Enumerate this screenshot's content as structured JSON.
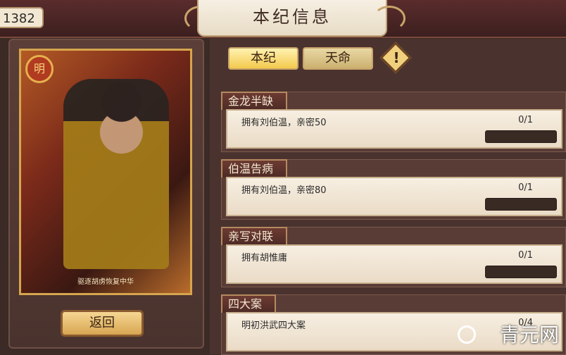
{
  "top_bar": {
    "counter": "1382",
    "title": "本纪信息"
  },
  "portrait": {
    "seal": "明",
    "caption": "驱逐胡虏恢复中华"
  },
  "left_panel": {
    "back_label": "返回"
  },
  "tabs": {
    "active": "本纪",
    "inactive": "天命",
    "info_icon": "exclamation-icon"
  },
  "quests": [
    {
      "title": "金龙半缺",
      "desc": "拥有刘伯温，亲密50",
      "progress": "0/1"
    },
    {
      "title": "伯温告病",
      "desc": "拥有刘伯温，亲密80",
      "progress": "0/1"
    },
    {
      "title": "亲写对联",
      "desc": "拥有胡惟庸",
      "progress": "0/1"
    },
    {
      "title": "四大案",
      "desc": "明初洪武四大案",
      "progress": "0/4"
    }
  ],
  "watermark": "青元网",
  "colors": {
    "accent": "#f3c94d",
    "panel": "#4a332e",
    "card_bg": "#f7efe2"
  }
}
